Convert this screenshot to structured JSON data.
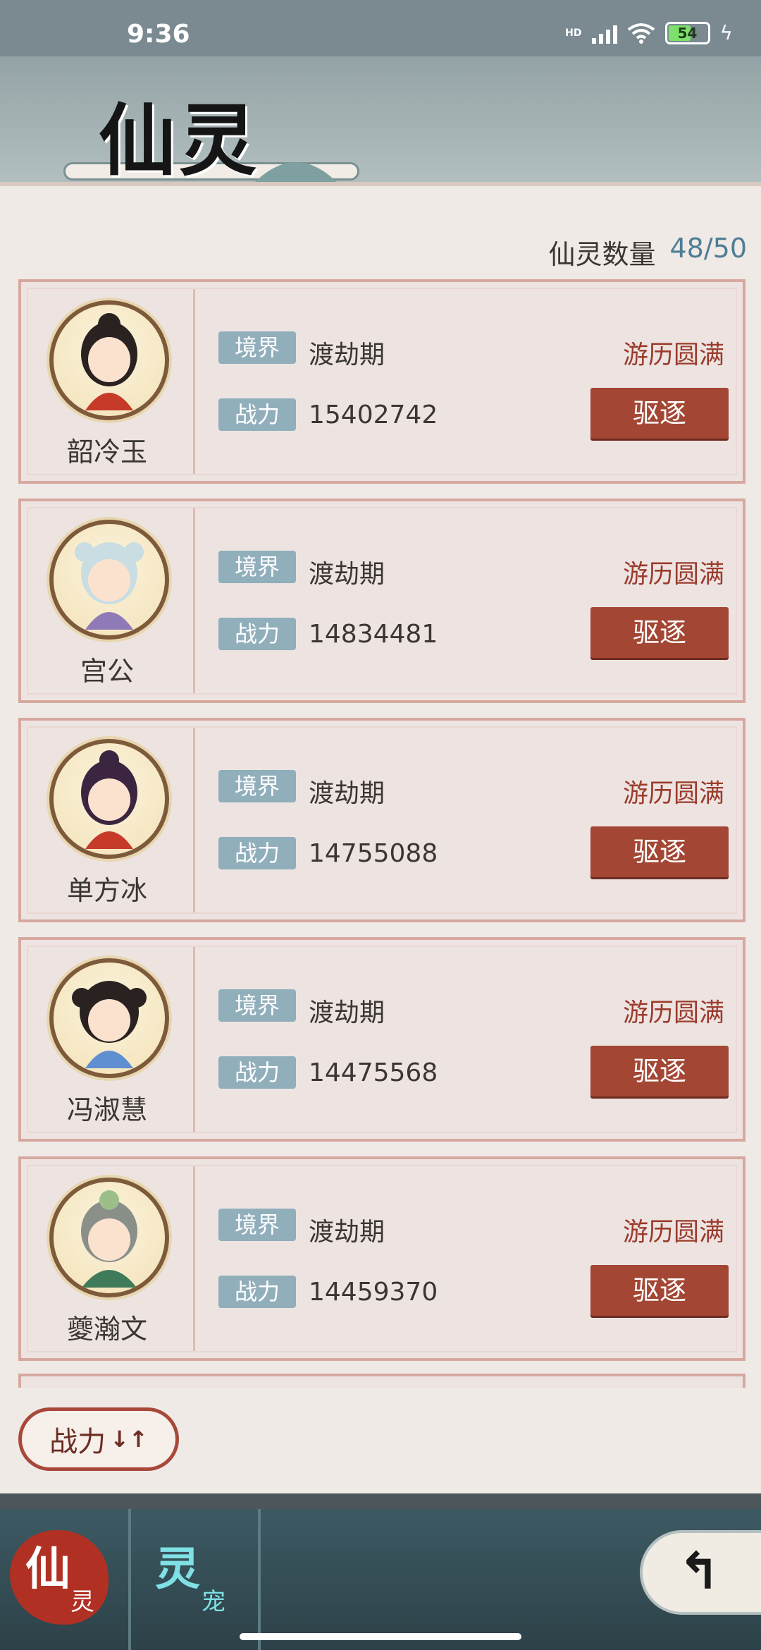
{
  "status_bar": {
    "time": "9:36",
    "network": "HD",
    "battery": "54"
  },
  "header": {
    "title": "仙灵"
  },
  "summary": {
    "label": "仙灵数量",
    "value": "48/50"
  },
  "labels": {
    "realm": "境界",
    "power": "战力",
    "expel": "驱逐"
  },
  "spirits": [
    {
      "name": "韶冷玉",
      "realm": "渡劫期",
      "power": "15402742",
      "status": "游历圆满"
    },
    {
      "name": "宫公",
      "realm": "渡劫期",
      "power": "14834481",
      "status": "游历圆满"
    },
    {
      "name": "单方冰",
      "realm": "渡劫期",
      "power": "14755088",
      "status": "游历圆满"
    },
    {
      "name": "冯淑慧",
      "realm": "渡劫期",
      "power": "14475568",
      "status": "游历圆满"
    },
    {
      "name": "夔瀚文",
      "realm": "渡劫期",
      "power": "14459370",
      "status": "游历圆满"
    }
  ],
  "sort_button": {
    "label": "战力",
    "arrows": "↓↑"
  },
  "nav": {
    "tab1_big": "仙",
    "tab1_small": "灵",
    "tab2_big": "灵",
    "tab2_small": "宠",
    "back": "↰"
  },
  "colors": {
    "accent_red": "#a34634",
    "tag_blue": "#91aebb",
    "count_blue": "#4f7d96",
    "status_red": "#9b3b2c"
  }
}
